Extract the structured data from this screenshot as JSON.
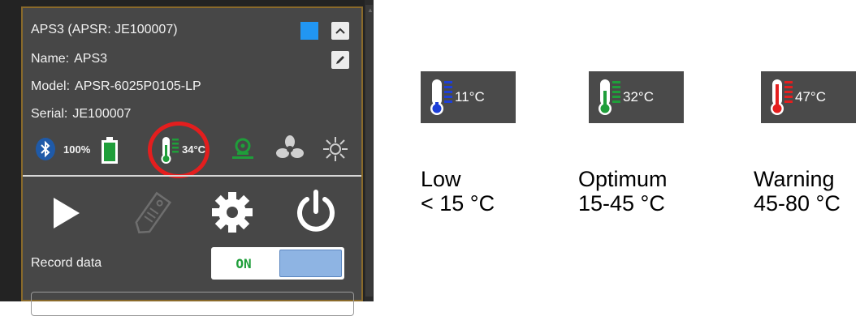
{
  "panel": {
    "title": "APS3 (APSR: JE100007)",
    "accent_color": "#2196f3",
    "name_label": "Name:",
    "name_value": "APS3",
    "model_label": "Model:",
    "model_value": "APSR-6025P0105-LP",
    "serial_label": "Serial:",
    "serial_value": "JE100007",
    "status": {
      "battery": "100%",
      "temperature": "34°C",
      "icons": [
        "bluetooth-icon",
        "battery-icon",
        "thermometer-icon",
        "sensor-icon",
        "fan-icon",
        "light-icon"
      ]
    },
    "actions": [
      "play-icon",
      "tag-icon",
      "gear-icon",
      "power-icon"
    ],
    "record_label": "Record data",
    "record_toggle": "ON"
  },
  "legend": [
    {
      "value": "11°C",
      "bar_color": "#1d3fd8",
      "bulb_color": "#1d3fd8",
      "line1": "Low",
      "line2": "< 15 °C"
    },
    {
      "value": "32°C",
      "bar_color": "#1f9e3a",
      "bulb_color": "#1f9e3a",
      "line1": "Optimum",
      "line2": "15-45 °C"
    },
    {
      "value": "47°C",
      "bar_color": "#e41e1e",
      "bulb_color": "#e41e1e",
      "line1": "Warning",
      "line2": "45-80 °C"
    }
  ]
}
